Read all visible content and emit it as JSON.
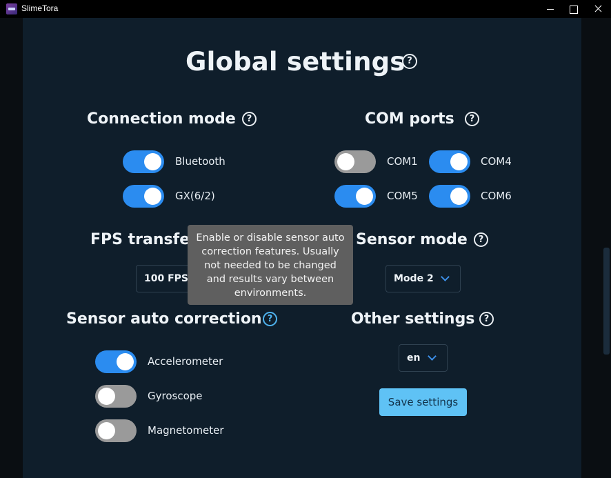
{
  "window": {
    "title": "SlimeTora"
  },
  "page": {
    "title": "Global settings",
    "help_icon": "question-circle-icon"
  },
  "connection_mode": {
    "title": "Connection mode",
    "options": [
      {
        "label": "Bluetooth",
        "enabled": true
      },
      {
        "label": "GX(6/2)",
        "enabled": true
      }
    ]
  },
  "com_ports": {
    "title": "COM ports",
    "ports": [
      {
        "label": "COM1",
        "enabled": false
      },
      {
        "label": "COM4",
        "enabled": true
      },
      {
        "label": "COM5",
        "enabled": true
      },
      {
        "label": "COM6",
        "enabled": true
      }
    ]
  },
  "fps_transfer": {
    "title": "FPS transfer",
    "selected": "100 FPS"
  },
  "sensor_mode": {
    "title": "Sensor mode",
    "selected": "Mode 2"
  },
  "sensor_auto_correction": {
    "title": "Sensor auto correction",
    "options": [
      {
        "label": "Accelerometer",
        "enabled": true
      },
      {
        "label": "Gyroscope",
        "enabled": false
      },
      {
        "label": "Magnetometer",
        "enabled": false
      }
    ],
    "tooltip": "Enable or disable sensor auto correction features. Usually not needed to be changed and results vary between environments."
  },
  "other_settings": {
    "title": "Other settings",
    "language": "en",
    "save_label": "Save settings"
  }
}
